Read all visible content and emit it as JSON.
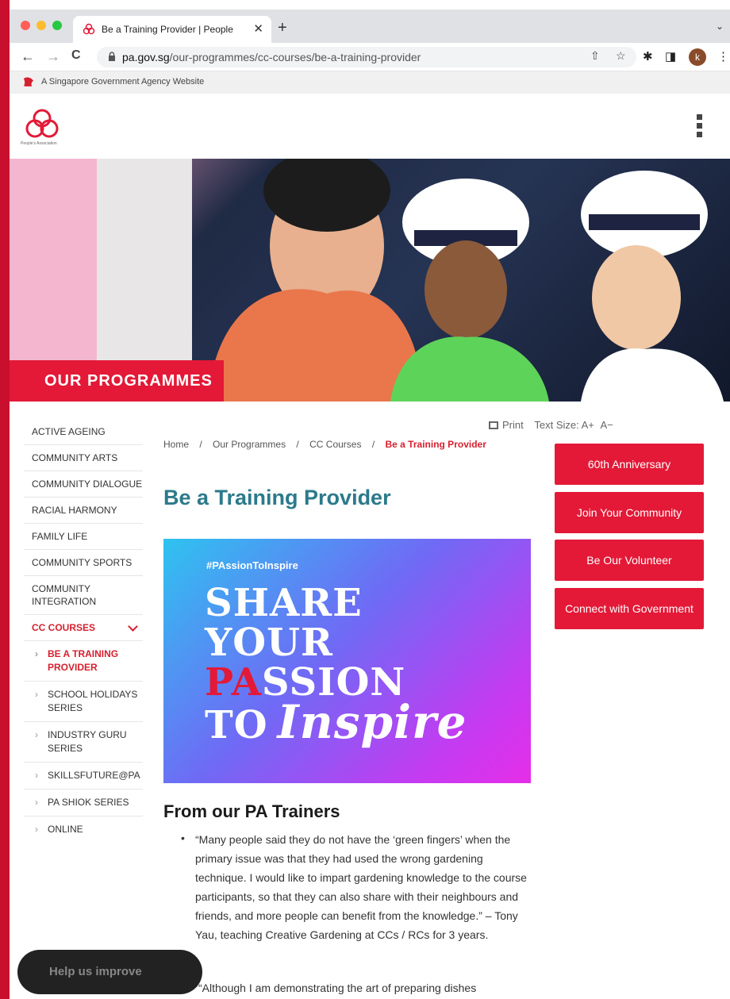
{
  "browser": {
    "tab_title": "Be a Training Provider | People",
    "tab_close": "✕",
    "new_tab": "+",
    "tab_menu": "⌄",
    "url_domain": "pa.gov.sg",
    "url_path": "/our-programmes/cc-courses/be-a-training-provider",
    "back": "←",
    "forward": "→",
    "reload": "C",
    "share_icon": "⇧",
    "bookmark_icon": "☆",
    "extensions_icon": "✱",
    "sidepanel_icon": "◨",
    "profile_initial": "k",
    "menu_icon": "⋮"
  },
  "gov_banner": {
    "text": "A Singapore Government Agency Website"
  },
  "site": {
    "logo_caption": "People's Association",
    "hero_banner": "OUR PROGRAMMES"
  },
  "sidebar": {
    "items": [
      {
        "label": "ACTIVE AGEING"
      },
      {
        "label": "COMMUNITY ARTS"
      },
      {
        "label": "COMMUNITY DIALOGUE"
      },
      {
        "label": "RACIAL HARMONY"
      },
      {
        "label": "FAMILY LIFE"
      },
      {
        "label": "COMMUNITY SPORTS"
      },
      {
        "label": "COMMUNITY INTEGRATION"
      },
      {
        "label": "CC COURSES"
      }
    ],
    "sub_items": [
      {
        "label": "BE A TRAINING PROVIDER"
      },
      {
        "label": "SCHOOL HOLIDAYS SERIES"
      },
      {
        "label": "INDUSTRY GURU SERIES"
      },
      {
        "label": "SKILLSFUTURE@PA"
      },
      {
        "label": "PA SHIOK SERIES"
      },
      {
        "label": "ONLINE"
      }
    ]
  },
  "utils": {
    "print": "Print",
    "text_size": "Text Size:",
    "increase": "A+",
    "decrease": "A−"
  },
  "breadcrumb": {
    "items": [
      "Home",
      "Our Programmes",
      "CC Courses"
    ],
    "current": "Be a Training Provider",
    "separator": "/"
  },
  "page": {
    "title": "Be a Training Provider",
    "promo": {
      "hashtag": "#PAssionToInspire",
      "line1": "SHARE",
      "line2": "YOUR",
      "line3_red": "PA",
      "line3_rest": "SSION",
      "line4": "TO",
      "line4_script": "Inspire"
    },
    "section_title": "From our PA Trainers",
    "bullet": "•",
    "quote1": "“Many people said they do not have the ‘green fingers’ when the primary issue was that they had used the wrong gardening technique. I would like to impart gardening knowledge to the course participants, so that they can also share with their neighbours and friends, and more people can benefit from the knowledge.” – Tony Yau, teaching Creative Gardening at CCs / RCs for 3 years.",
    "quote2": "“Although I am demonstrating the art of preparing dishes"
  },
  "right_buttons": [
    {
      "label": "60th Anniversary"
    },
    {
      "label": "Join Your Community"
    },
    {
      "label": "Be Our Volunteer"
    },
    {
      "label": "Connect with Government"
    }
  ],
  "help": {
    "label": "Help us improve"
  },
  "colors": {
    "brand_red": "#e31937",
    "title_teal": "#2b7a8b",
    "frame_red": "#c8102e"
  }
}
